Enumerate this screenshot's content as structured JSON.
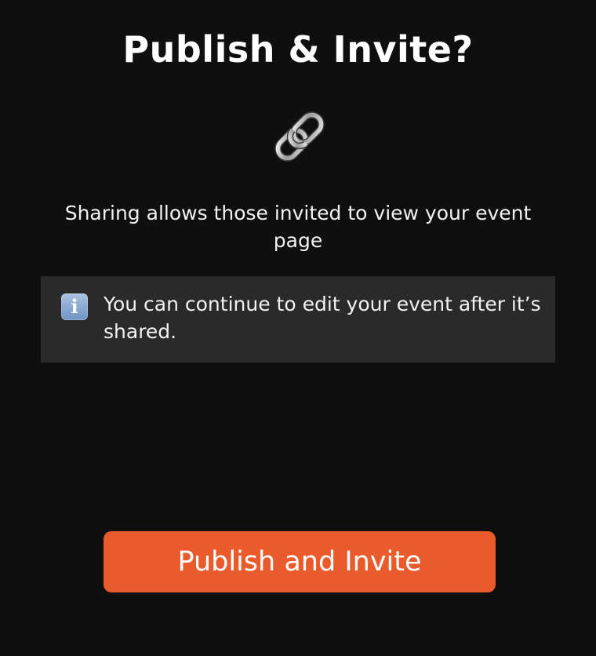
{
  "dialog": {
    "title": "Publish & Invite?",
    "icon": "link-icon",
    "description": "Sharing allows those invited to view your event page",
    "notice": {
      "icon": "info-icon",
      "icon_glyph": "i",
      "text": "You can continue to edit your event after it’s shared."
    },
    "primary_button_label": "Publish and Invite"
  },
  "colors": {
    "background": "#0f0f0f",
    "notice_background": "#2a2a2a",
    "accent": "#eb5a2b",
    "text": "#ffffff"
  }
}
